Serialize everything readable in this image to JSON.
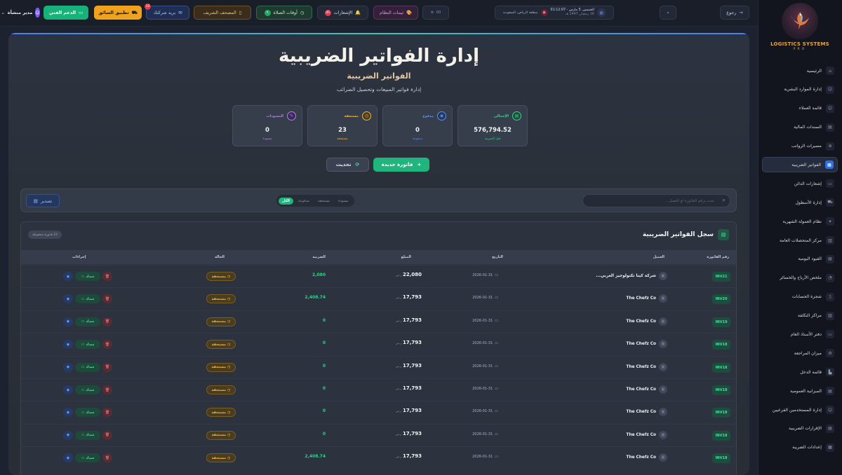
{
  "sidebar": {
    "logo_text": "LOGISTICS SYSTEMS",
    "logo_sub": "PRO",
    "items": [
      {
        "label": "الرئيسية",
        "icon": "home-icon",
        "glyph": "⌂",
        "active": false
      },
      {
        "label": "إدارة الموارد البشرية",
        "icon": "people-icon",
        "glyph": "☺",
        "active": false
      },
      {
        "label": "قائمة العملاء",
        "icon": "users-icon",
        "glyph": "☺",
        "active": false
      },
      {
        "label": "السندات المالية",
        "icon": "receipt-icon",
        "glyph": "▤",
        "active": false
      },
      {
        "label": "مسيرات الرواتب",
        "icon": "salary-icon",
        "glyph": "⊕",
        "active": false
      },
      {
        "label": "الفواتير الضريبية",
        "icon": "invoice-icon",
        "glyph": "▦",
        "active": true
      },
      {
        "label": "إشعارات الدائن",
        "icon": "credit-card-icon",
        "glyph": "▭",
        "active": false
      },
      {
        "label": "إدارة الأسطول",
        "icon": "truck-icon",
        "glyph": "⛟",
        "active": false
      },
      {
        "label": "نظام العمولة الشهرية",
        "icon": "commission-icon",
        "glyph": "✦",
        "active": false
      },
      {
        "label": "مركز المتحصلات العامة",
        "icon": "collections-icon",
        "glyph": "▥",
        "active": false
      },
      {
        "label": "القيود اليومية",
        "icon": "journal-icon",
        "glyph": "▤",
        "active": false
      },
      {
        "label": "ملخص الأرباح والخسائر",
        "icon": "pie-chart-icon",
        "glyph": "◔",
        "active": false
      },
      {
        "label": "شجرة الحسابات",
        "icon": "book-icon",
        "glyph": "▯",
        "active": false
      },
      {
        "label": "مراكز التكلفة",
        "icon": "building-icon",
        "glyph": "▥",
        "active": false
      },
      {
        "label": "دفتر الأستاذ العام",
        "icon": "ledger-icon",
        "glyph": "▭",
        "active": false
      },
      {
        "label": "ميزان المراجعة",
        "icon": "scale-icon",
        "glyph": "⚙",
        "active": false
      },
      {
        "label": "قائمة الدخل",
        "icon": "bar-chart-icon",
        "glyph": "▙",
        "active": false
      },
      {
        "label": "الميزانية العمومية",
        "icon": "document-icon",
        "glyph": "▤",
        "active": false
      },
      {
        "label": "إدارة المستخدمين الفرعيين",
        "icon": "sub-users-icon",
        "glyph": "☺",
        "active": false
      },
      {
        "label": "الإقرارات الضريبية",
        "icon": "tax-return-icon",
        "glyph": "▤",
        "active": false
      },
      {
        "label": "إعدادات الضريبة",
        "icon": "tax-settings-icon",
        "glyph": "▦",
        "active": false
      }
    ]
  },
  "topbar": {
    "back_label": "رجوع",
    "clock_line1": "الخميس، 5 مارس - 01:12:07",
    "clock_line2": "16 رمضان 1447 هـ",
    "region_label": "منطقة الرياض، السعودية",
    "mini_label": "00",
    "theme_label": "ثيمات النظام",
    "notifications_label": "الإشعارات",
    "notifications_count": "45",
    "prayer_label": "أوقات الصلاة",
    "prayer_badge": "٩",
    "quran_label": "المصحف الشريف",
    "mail_label": "بريد شركتك",
    "mail_badge": "10",
    "driver_label": "تطبيق السائق",
    "support_label": "الدعم الفني",
    "user_label": "مدير منشأة"
  },
  "hero": {
    "title": "إدارة الفواتير الضريبية",
    "subtitle": "الفواتير الضريبية",
    "description": "إدارة فواتير المبيعات وتحصيل الضرائب"
  },
  "stats": [
    {
      "label": "الإجمالي",
      "value": "576,794.52",
      "caption": "قبل الضريبة",
      "color": "#39d48f",
      "bg": "#1f4a39",
      "icon": "total-icon",
      "glyph": "▤"
    },
    {
      "label": "مدفوع",
      "value": "0",
      "caption": "مدفوعة",
      "color": "#5b8ff0",
      "bg": "#23375f",
      "icon": "paid-icon",
      "glyph": "◉"
    },
    {
      "label": "مستحقة",
      "value": "23",
      "caption": "مستحقة",
      "color": "#f0b442",
      "bg": "#4a3c1f",
      "icon": "due-icon",
      "glyph": "◷"
    },
    {
      "label": "المسودات",
      "value": "0",
      "caption": "مسودة",
      "color": "#b27ef0",
      "bg": "#3b2b57",
      "icon": "drafts-icon",
      "glyph": "✎"
    }
  ],
  "actions": {
    "new_invoice": "فاتورة جديدة",
    "refresh": "تحديث"
  },
  "filters": {
    "search_placeholder": "بحث برقم الفاتورة أو العميل...",
    "tabs": [
      "الكل",
      "مدفوعة",
      "مستحقة",
      "مسودة"
    ],
    "export_label": "تصدير"
  },
  "table": {
    "title": "سجل الفواتير الضريبية",
    "count_label": "23 فاتورة محفوظة",
    "headers": {
      "number": "رقم الفاتورة",
      "client": "العميل",
      "date": "التاريخ",
      "amount": "المبلغ",
      "tax": "الضريبة",
      "status": "الحالة",
      "actions": "إجراءات"
    },
    "currency": "ر.س",
    "pay_label": "سداد",
    "rows": [
      {
        "number": "INV21",
        "client": "شركة كيتا تكنولوجيز العربي...",
        "date": "2026-01-31",
        "amount": "22,080",
        "tax": "2,080",
        "status": "مستحقة"
      },
      {
        "number": "INV20",
        "client": "The Chefz Co",
        "date": "2026-01-31",
        "amount": "17,793",
        "tax": "2,408.74",
        "status": "مستحقة"
      },
      {
        "number": "INV19",
        "client": "The Chefz Co",
        "date": "2026-01-31",
        "amount": "17,793",
        "tax": "0",
        "status": "مستحقة"
      },
      {
        "number": "INV18",
        "client": "The Chefz Co",
        "date": "2026-01-31",
        "amount": "17,793",
        "tax": "0",
        "status": "مستحقة"
      },
      {
        "number": "INV18",
        "client": "The Chefz Co",
        "date": "2026-01-31",
        "amount": "17,793",
        "tax": "0",
        "status": "مستحقة"
      },
      {
        "number": "INV18",
        "client": "The Chefz Co",
        "date": "2026-01-31",
        "amount": "17,793",
        "tax": "0",
        "status": "مستحقة"
      },
      {
        "number": "INV18",
        "client": "The Chefz Co",
        "date": "2026-01-31",
        "amount": "17,793",
        "tax": "0",
        "status": "مستحقة"
      },
      {
        "number": "INV18",
        "client": "The Chefz Co",
        "date": "2026-01-31",
        "amount": "17,793",
        "tax": "0",
        "status": "مستحقة"
      },
      {
        "number": "INV18",
        "client": "The Chefz Co",
        "date": "2026-01-31",
        "amount": "17,793",
        "tax": "2,408.74",
        "status": "مستحقة"
      }
    ]
  }
}
